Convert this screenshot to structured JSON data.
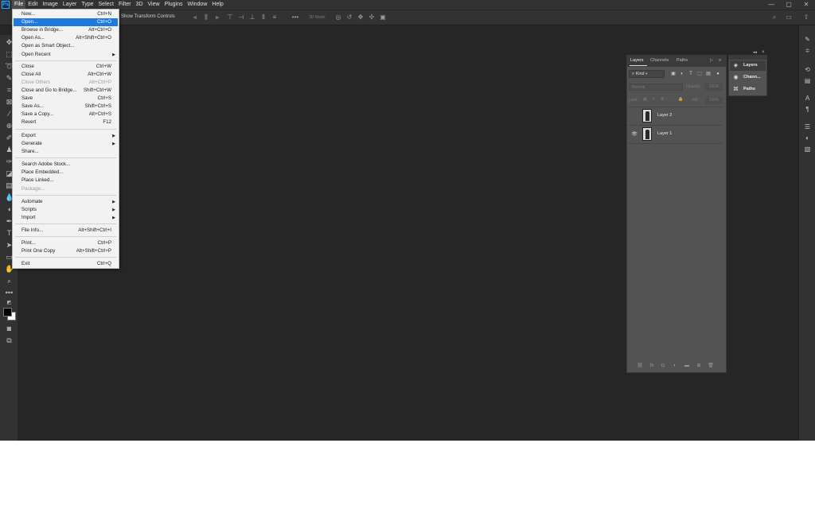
{
  "app": {
    "logo": "Ps",
    "menus": [
      "File",
      "Edit",
      "Image",
      "Layer",
      "Type",
      "Select",
      "Filter",
      "3D",
      "View",
      "Plugins",
      "Window",
      "Help"
    ],
    "active_menu": "File",
    "window_controls": [
      "—",
      "▢",
      "✕"
    ]
  },
  "options_bar": {
    "show_transform_controls": "Show Transform Controls",
    "mode_3d": "3D Mode:"
  },
  "file_menu": [
    {
      "label": "New...",
      "shortcut": "Ctrl+N"
    },
    {
      "label": "Open...",
      "shortcut": "Ctrl+O",
      "highlight": true
    },
    {
      "label": "Browse in Bridge...",
      "shortcut": "Alt+Ctrl+O"
    },
    {
      "label": "Open As...",
      "shortcut": "Alt+Shift+Ctrl+O"
    },
    {
      "label": "Open as Smart Object...",
      "shortcut": ""
    },
    {
      "label": "Open Recent",
      "shortcut": "",
      "submenu": true
    },
    {
      "label": "Close",
      "shortcut": "Ctrl+W"
    },
    {
      "label": "Close All",
      "shortcut": "Alt+Ctrl+W"
    },
    {
      "label": "Close Others",
      "shortcut": "Alt+Ctrl+P",
      "disabled": true
    },
    {
      "label": "Close and Go to Bridge...",
      "shortcut": "Shift+Ctrl+W"
    },
    {
      "label": "Save",
      "shortcut": "Ctrl+S"
    },
    {
      "label": "Save As...",
      "shortcut": "Shift+Ctrl+S"
    },
    {
      "label": "Save a Copy...",
      "shortcut": "Alt+Ctrl+S"
    },
    {
      "label": "Revert",
      "shortcut": "F12"
    },
    {
      "label": "Export",
      "shortcut": "",
      "submenu": true
    },
    {
      "label": "Generate",
      "shortcut": "",
      "submenu": true
    },
    {
      "label": "Share...",
      "shortcut": ""
    },
    {
      "label": "Search Adobe Stock...",
      "shortcut": ""
    },
    {
      "label": "Place Embedded...",
      "shortcut": ""
    },
    {
      "label": "Place Linked...",
      "shortcut": ""
    },
    {
      "label": "Package...",
      "shortcut": "",
      "disabled": true
    },
    {
      "label": "Automate",
      "shortcut": "",
      "submenu": true
    },
    {
      "label": "Scripts",
      "shortcut": "",
      "submenu": true
    },
    {
      "label": "Import",
      "shortcut": "",
      "submenu": true
    },
    {
      "label": "File Info...",
      "shortcut": "Alt+Shift+Ctrl+I"
    },
    {
      "label": "Print...",
      "shortcut": "Ctrl+P"
    },
    {
      "label": "Print One Copy",
      "shortcut": "Alt+Shift+Ctrl+P"
    },
    {
      "label": "Exit",
      "shortcut": "Ctrl+Q"
    }
  ],
  "layers_panel": {
    "tabs": [
      "Layers",
      "Channels",
      "Paths"
    ],
    "active_tab": "Layers",
    "filter_kind": "Kind",
    "blend_mode": "Normal",
    "opacity_label": "Opacity:",
    "opacity_value": "100%",
    "lock_label": "Lock:",
    "fill_label": "Fill:",
    "fill_value": "100%",
    "layers": [
      {
        "name": "Layer 2",
        "visible": false
      },
      {
        "name": "Layer 1",
        "visible": true
      }
    ]
  },
  "dock": {
    "items": [
      "Layers",
      "Chann...",
      "Paths"
    ]
  },
  "colors": {
    "workspace": "#262626",
    "chrome": "#323232",
    "panel": "#535353",
    "menu_highlight": "#1f7ae0"
  }
}
